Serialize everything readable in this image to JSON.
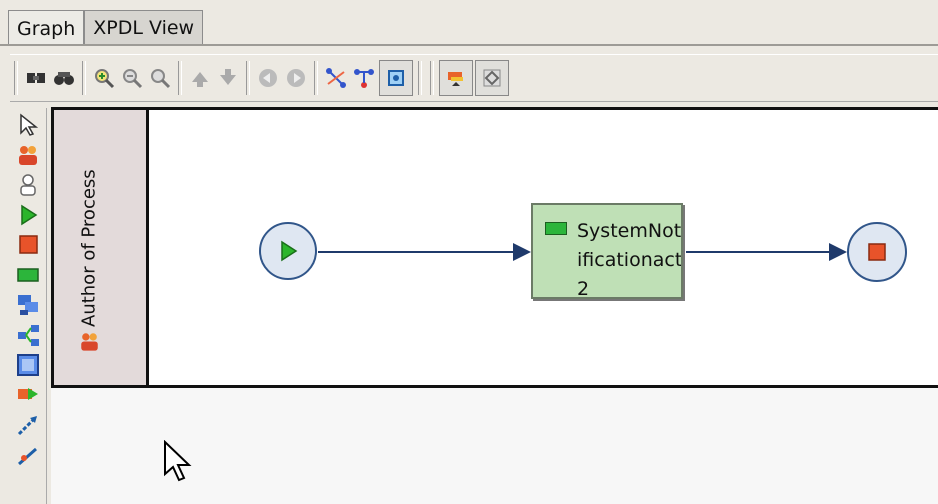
{
  "tabs": [
    {
      "label": "Graph",
      "active": true
    },
    {
      "label": "XPDL View",
      "active": false
    }
  ],
  "toolbar_icons": [
    "cursor-binoculars-icon",
    "binoculars-icon",
    "zoom-in-icon",
    "zoom-out-icon",
    "zoom-reset-icon",
    "move-up-icon",
    "move-down-icon",
    "back-icon",
    "forward-icon",
    "insert-node-icon",
    "remove-node-icon",
    "connect-icon",
    "activity-set-icon",
    "overview-icon"
  ],
  "palette_icons": [
    "select-icon",
    "participant-role-icon",
    "participant-icon",
    "start-icon",
    "end-icon",
    "generic-activity-icon",
    "subflow-icon",
    "route-icon",
    "block-activity-icon",
    "tool-activity-icon",
    "transition-icon",
    "self-transition-icon"
  ],
  "pool": {
    "lane_label": "Author of Process"
  },
  "activity": {
    "name": "SystemNotificationact2"
  },
  "colors": {
    "start_play": "#2bb52b",
    "end_stop": "#e8532a",
    "activity_fill": "#bfe0b6",
    "transition": "#1f3a6b"
  }
}
